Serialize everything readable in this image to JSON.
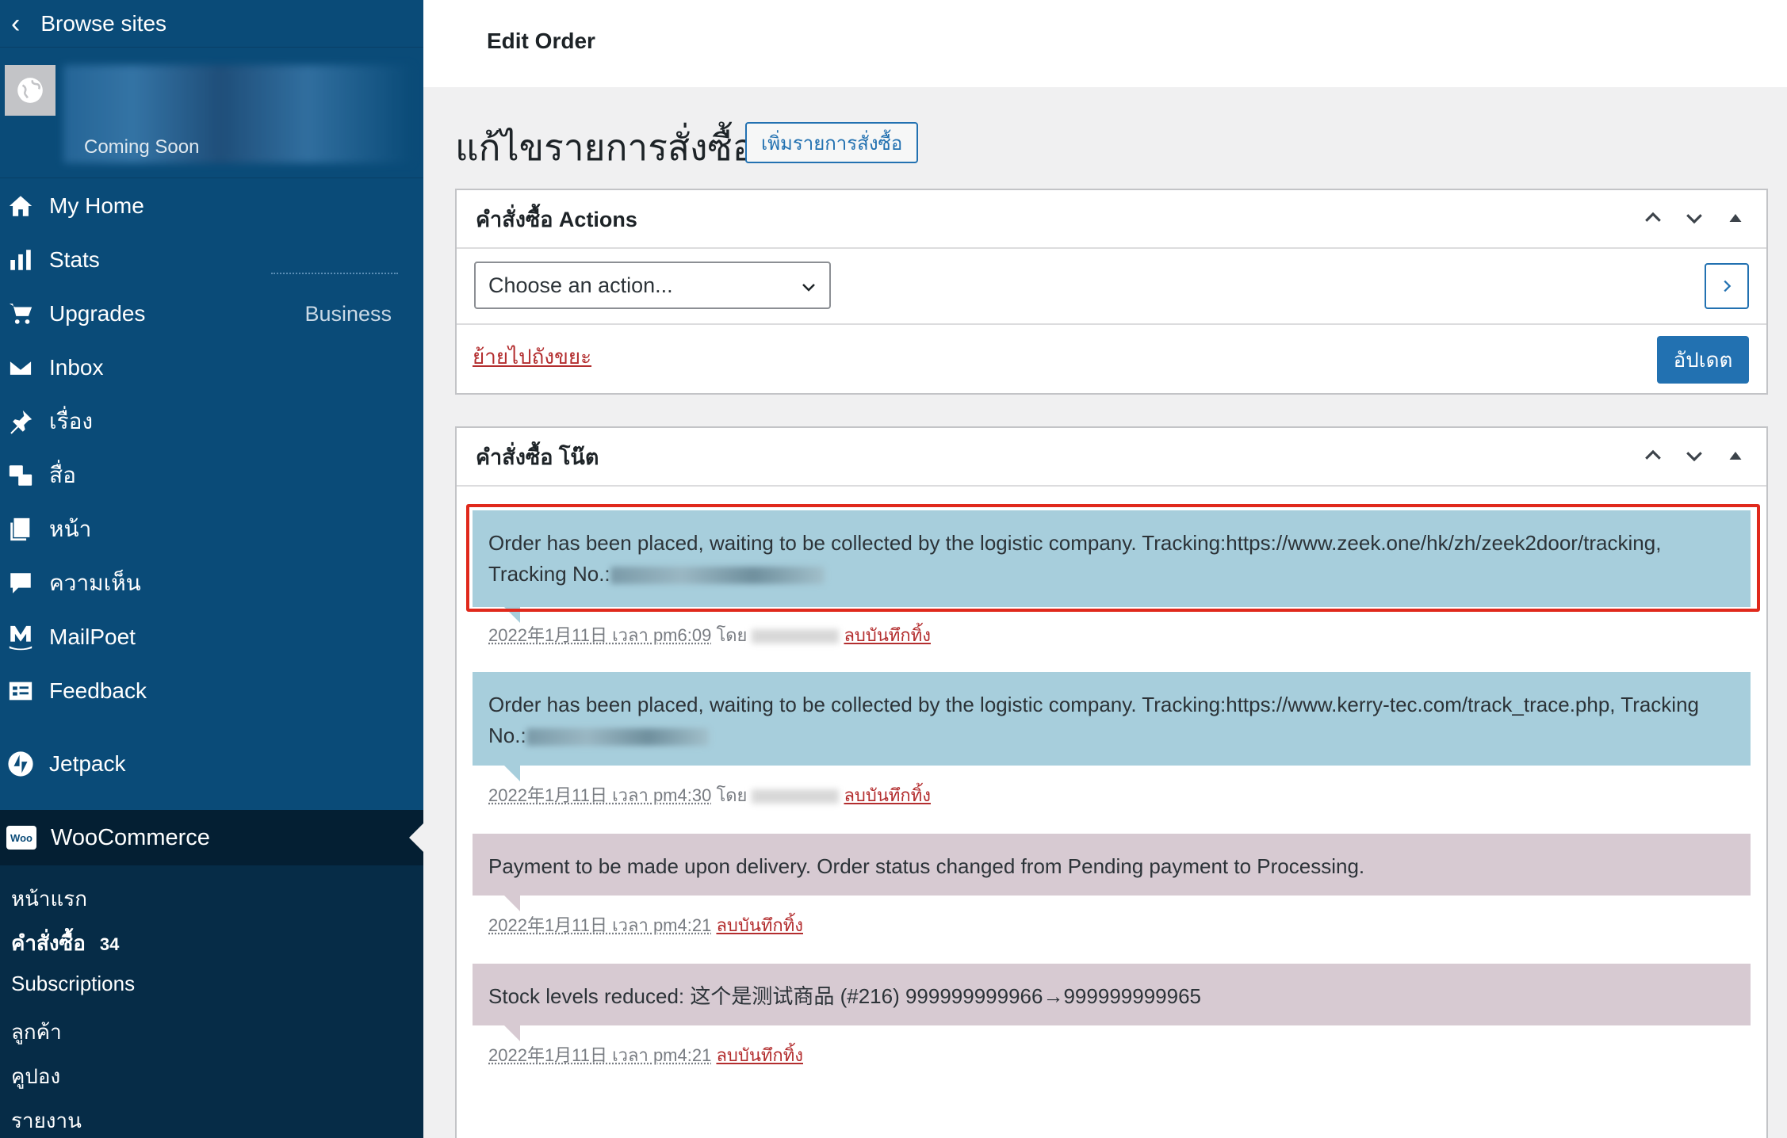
{
  "sidebar": {
    "browse_label": "Browse sites",
    "site_status": "Coming Soon",
    "plan_badge": "Business",
    "items": [
      {
        "label": "My Home",
        "icon": "home-icon"
      },
      {
        "label": "Stats",
        "icon": "stats-icon"
      },
      {
        "label": "Upgrades",
        "icon": "cart-icon"
      },
      {
        "label": "Inbox",
        "icon": "mail-icon"
      },
      {
        "label": "เรื่อง",
        "icon": "pin-icon"
      },
      {
        "label": "สื่อ",
        "icon": "media-icon"
      },
      {
        "label": "หน้า",
        "icon": "page-icon"
      },
      {
        "label": "ความเห็น",
        "icon": "comment-icon"
      },
      {
        "label": "MailPoet",
        "icon": "mailpoet-icon"
      },
      {
        "label": "Feedback",
        "icon": "feedback-icon"
      },
      {
        "label": "Jetpack",
        "icon": "jetpack-icon"
      }
    ],
    "woocommerce": {
      "label": "WooCommerce",
      "badge": "Woo",
      "submenu": [
        {
          "label": "หน้าแรก"
        },
        {
          "label": "คำสั่งซื้อ",
          "count": "34"
        },
        {
          "label": "Subscriptions"
        },
        {
          "label": "ลูกค้า"
        },
        {
          "label": "คูปอง"
        },
        {
          "label": "รายงาน"
        }
      ]
    }
  },
  "topbar": {
    "title": "Edit Order"
  },
  "page": {
    "title": "แก้ไขรายการสั่งซื้อ",
    "add_button": "เพิ่มรายการสั่งซื้อ"
  },
  "actions_panel": {
    "title": "คำสั่งซื้อ Actions",
    "select_value": "Choose an action...",
    "trash_link": "ย้ายไปถังขยะ",
    "update_button": "อัปเดต"
  },
  "notes_panel": {
    "title": "คำสั่งซื้อ โน๊ต",
    "notes": [
      {
        "text": "Order has been placed, waiting to be collected by the logistic company. Tracking:https://www.zeek.one/hk/zh/zeek2door/tracking, Tracking No.:",
        "date": "2022年1月11日 เวลา pm6:09",
        "by": "โดย",
        "delete": "ลบบันทึกทิ้ง",
        "type": "customer"
      },
      {
        "text": "Order has been placed, waiting to be collected by the logistic company. Tracking:https://www.kerry-tec.com/track_trace.php, Tracking No.:",
        "date": "2022年1月11日 เวลา pm4:30",
        "by": "โดย",
        "delete": "ลบบันทึกทิ้ง",
        "type": "customer"
      },
      {
        "text": "Payment to be made upon delivery. Order status changed from Pending payment to Processing.",
        "date": "2022年1月11日 เวลา pm4:21",
        "delete": "ลบบันทึกทิ้ง",
        "type": "system"
      },
      {
        "text": "Stock levels reduced: 这个是测试商品 (#216) 999999999966→999999999965",
        "date": "2022年1月11日 เวลา pm4:21",
        "delete": "ลบบันทึกทิ้ง",
        "type": "system"
      }
    ]
  },
  "colors": {
    "sidebar_bg": "#0a4b78",
    "accent": "#2271b1",
    "customer_note": "#a7cedc",
    "system_note": "#d7cad2",
    "highlight": "#e0291c",
    "delete_link": "#b32d2e"
  }
}
